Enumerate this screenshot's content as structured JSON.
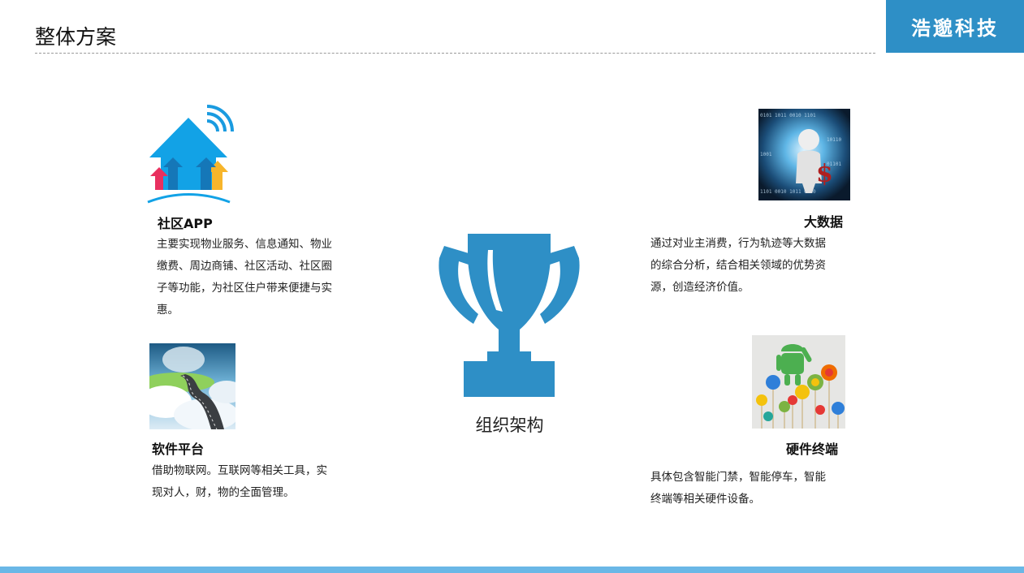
{
  "header": {
    "title": "整体方案",
    "brand": "浩邈科技"
  },
  "center": {
    "label": "组织架构",
    "icon": "trophy-icon",
    "color": "#2e8fc6"
  },
  "sections": {
    "community_app": {
      "heading": "社区APP",
      "lines": [
        "主要实现物业服务、信息通知、物业",
        "缴费、周边商铺、社区活动、社区圈",
        "子等功能，为社区住户带来便捷与实",
        "惠。"
      ],
      "icon": "smart-home-icon"
    },
    "software_platform": {
      "heading": "软件平台",
      "lines": [
        "借助物联网。互联网等相关工具，实",
        "现对人，财，物的全面管理。"
      ],
      "icon": "cloud-road-image"
    },
    "big_data": {
      "heading": "大数据",
      "lines": [
        "通过对业主消费，行为轨迹等大数据",
        "的综合分析，结合相关领域的优势资",
        "源，创造经济价值。"
      ],
      "icon": "data-tunnel-image"
    },
    "hardware": {
      "heading": "硬件终端",
      "lines": [
        "具体包含智能门禁，智能停车，智能",
        "终端等相关硬件设备。"
      ],
      "icon": "android-lollipop-image"
    }
  },
  "colors": {
    "accent": "#2e8fc6",
    "bottom_bar": "#6ab7e6"
  }
}
